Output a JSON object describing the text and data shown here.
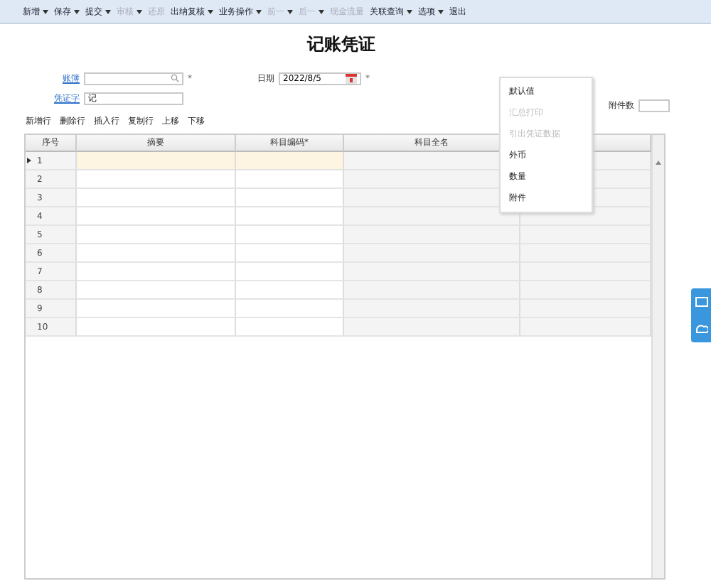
{
  "toolbar": [
    {
      "label": "新增",
      "dropdown": true,
      "disabled": false
    },
    {
      "label": "保存",
      "dropdown": true,
      "disabled": false
    },
    {
      "label": "提交",
      "dropdown": true,
      "disabled": false
    },
    {
      "label": "审核",
      "dropdown": true,
      "disabled": true
    },
    {
      "label": "还原",
      "dropdown": false,
      "disabled": true
    },
    {
      "label": "出纳复核",
      "dropdown": true,
      "disabled": false
    },
    {
      "label": "业务操作",
      "dropdown": true,
      "disabled": false
    },
    {
      "label": "前一",
      "dropdown": true,
      "disabled": true
    },
    {
      "label": "后一",
      "dropdown": true,
      "disabled": true
    },
    {
      "label": "现金流量",
      "dropdown": false,
      "disabled": true
    },
    {
      "label": "关联查询",
      "dropdown": true,
      "disabled": false
    },
    {
      "label": "选项",
      "dropdown": true,
      "disabled": false
    },
    {
      "label": "退出",
      "dropdown": false,
      "disabled": false
    }
  ],
  "title": "记账凭证",
  "form": {
    "book": {
      "label": "账簿",
      "required_mark": "*"
    },
    "voucher_word": {
      "label": "凭证字",
      "value": "记"
    },
    "date": {
      "label": "日期",
      "value": "2022/8/5",
      "required_mark": "*"
    },
    "attachments": {
      "label": "附件数"
    }
  },
  "row_actions": [
    "新增行",
    "删除行",
    "插入行",
    "复制行",
    "上移",
    "下移"
  ],
  "table": {
    "columns": [
      "序号",
      "摘要",
      "科目编码*",
      "科目全名",
      ""
    ],
    "rows": [
      {
        "no": "1",
        "selected": true
      },
      {
        "no": "2",
        "selected": false
      },
      {
        "no": "3",
        "selected": false
      },
      {
        "no": "4",
        "selected": false
      },
      {
        "no": "5",
        "selected": false
      },
      {
        "no": "6",
        "selected": false
      },
      {
        "no": "7",
        "selected": false
      },
      {
        "no": "8",
        "selected": false
      },
      {
        "no": "9",
        "selected": false
      },
      {
        "no": "10",
        "selected": false
      }
    ]
  },
  "menu": [
    {
      "label": "默认值",
      "disabled": false
    },
    {
      "label": "汇总打印",
      "disabled": true
    },
    {
      "label": "引出凭证数据",
      "disabled": true
    },
    {
      "label": "外币",
      "disabled": false
    },
    {
      "label": "数量",
      "disabled": false
    },
    {
      "label": "附件",
      "disabled": false
    }
  ]
}
